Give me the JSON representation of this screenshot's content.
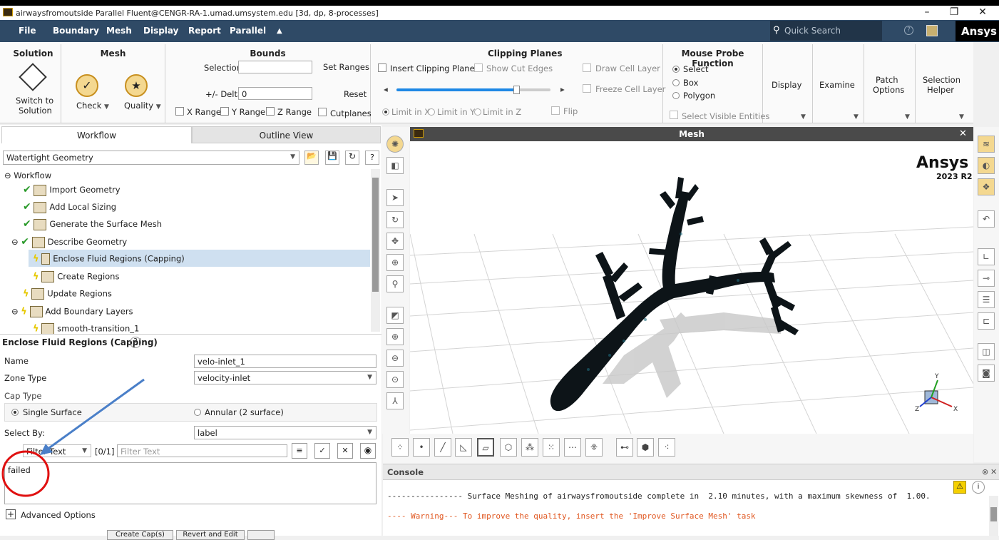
{
  "window": {
    "title": "airwaysfromoutside Parallel Fluent@CENGR-RA-1.umad.umsystem.edu  [3d, dp, 8-processes]",
    "min": "–",
    "restore": "❐",
    "close": "✕"
  },
  "menu": {
    "items": [
      "File",
      "Boundary",
      "Mesh",
      "Display",
      "Report",
      "Parallel",
      "▲"
    ],
    "search_placeholder": "Quick Search",
    "brand": "Ansys"
  },
  "ribbon": {
    "solution": {
      "title": "Solution",
      "switch_label_1": "Switch to",
      "switch_label_2": "Solution"
    },
    "mesh": {
      "title": "Mesh",
      "check": "Check",
      "quality": "Quality"
    },
    "bounds": {
      "title": "Bounds",
      "selection": "Selection",
      "set_ranges": "Set Ranges",
      "delta_label": "+/- Delta",
      "delta_value": "0",
      "reset": "Reset",
      "x_range": "X Range",
      "y_range": "Y Range",
      "z_range": "Z Range",
      "cutplanes": "Cutplanes"
    },
    "clipping": {
      "title": "Clipping Planes",
      "insert": "Insert Clipping Planes",
      "show_cut": "Show Cut Edges",
      "draw_cell": "Draw Cell Layer",
      "freeze_cell": "Freeze Cell Layer",
      "limit_x": "Limit in X",
      "limit_y": "Limit in Y",
      "limit_z": "Limit in Z",
      "flip": "Flip",
      "slider_fraction": 0.78
    },
    "probe": {
      "title": "Mouse Probe Function",
      "select": "Select",
      "box": "Box",
      "polygon": "Polygon",
      "visible": "Select Visible Entities"
    },
    "display": "Display",
    "examine": "Examine",
    "patch_1": "Patch",
    "patch_2": "Options",
    "helper_1": "Selection",
    "helper_2": "Helper"
  },
  "left": {
    "tabs": [
      "Workflow",
      "Outline View"
    ],
    "workflow_type": "Watertight Geometry",
    "tree_root": "Workflow",
    "tree": [
      "Import Geometry",
      "Add Local Sizing",
      "Generate the Surface Mesh",
      "Describe Geometry",
      "Enclose Fluid Regions (Capping)",
      "Create Regions",
      "Update Regions",
      "Add Boundary Layers",
      "smooth-transition_1"
    ],
    "task_title": "Enclose Fluid Regions (Capping)",
    "name_label": "Name",
    "name_value": "velo-inlet_1",
    "zone_label": "Zone Type",
    "zone_value": "velocity-inlet",
    "cap_label": "Cap Type",
    "cap_single": "Single Surface",
    "cap_annular": "Annular (2 surface)",
    "select_label": "Select By:",
    "select_value": "label",
    "filter_value": "Filter Text",
    "count": "[0/1]",
    "filter_placeholder": "Filter Text",
    "list_text": "failed",
    "advanced": "Advanced Options",
    "bottom_1": "Create Cap(s)",
    "bottom_2": "Revert and Edit"
  },
  "viewport": {
    "title": "Mesh",
    "brand": "Ansys",
    "version": "2023 R2"
  },
  "console": {
    "title": "Console",
    "line1": "---------------- Surface Meshing of airwaysfromoutside complete in  2.10 minutes, with a maximum skewness of  1.00.",
    "line2": "---- Warning--- To improve the quality, insert the 'Improve Surface Mesh' task"
  },
  "colors": {
    "menubar": "#2f4a66",
    "accent": "#d9a400",
    "warning": "#e0561f",
    "selected_row": "#cfe0f0",
    "annotation_arrow": "#4a7fc8",
    "annotation_circle": "#e01010"
  }
}
